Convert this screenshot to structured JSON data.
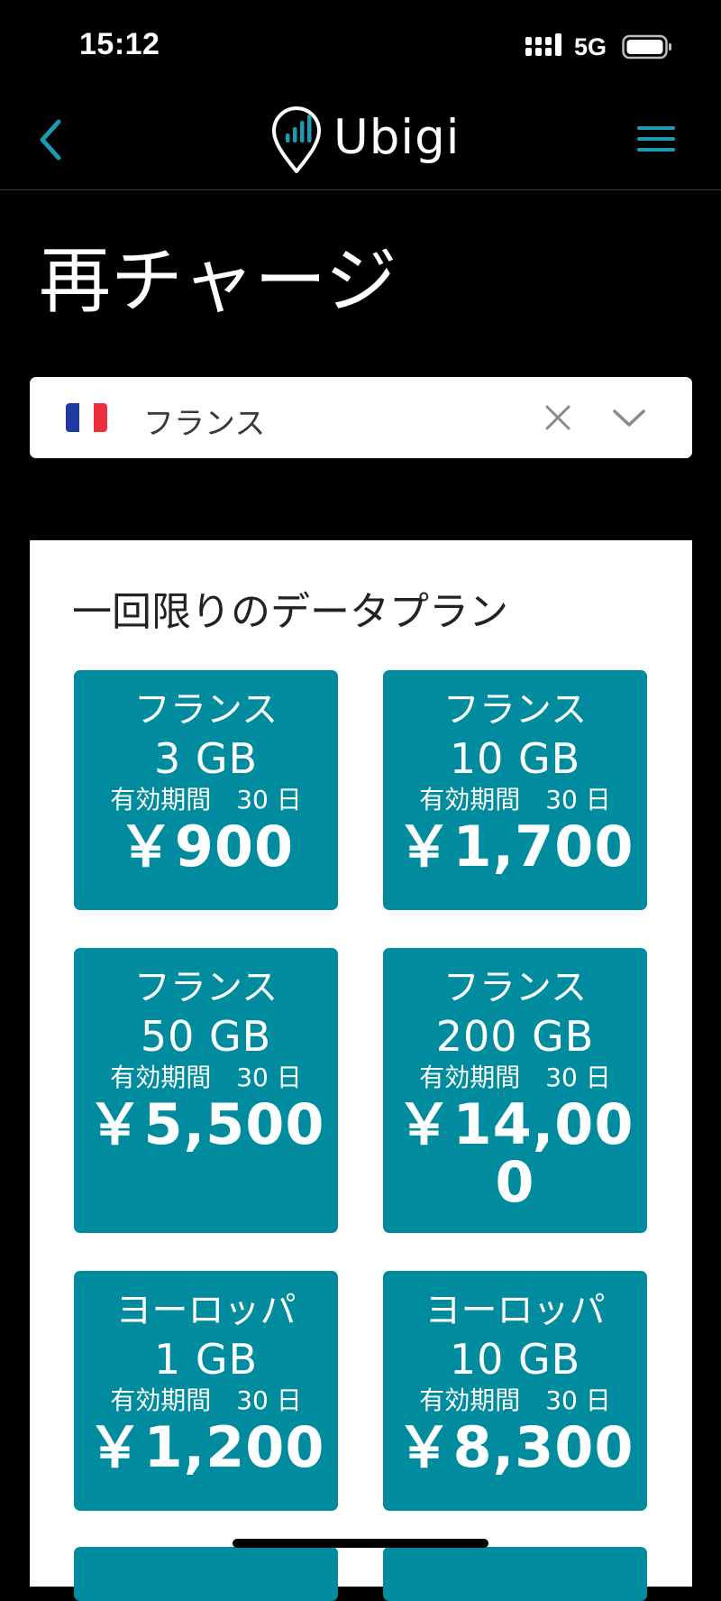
{
  "status_bar": {
    "time": "15:12",
    "network": "5G",
    "icons": [
      "signal-icon",
      "battery-icon"
    ]
  },
  "nav": {
    "logo_text": "Ubigi",
    "icons": [
      "back-arrow-icon",
      "location-pin-signal-icon",
      "hamburger-menu-icon"
    ],
    "accent_color": "#1a9bb0"
  },
  "page": {
    "title": "再チャージ"
  },
  "country_select": {
    "selected": "フランス",
    "flag": "france-flag-icon",
    "icons": [
      "clear-x-icon",
      "chevron-down-icon"
    ]
  },
  "plans": {
    "heading": "一回限りのデータプラン",
    "card_color": "#008c9e",
    "items": [
      {
        "region": "フランス",
        "data": "3 GB",
        "validity": "有効期間　30 日",
        "price": "￥900"
      },
      {
        "region": "フランス",
        "data": "10 GB",
        "validity": "有効期間　30 日",
        "price": "￥1,700"
      },
      {
        "region": "フランス",
        "data": "50 GB",
        "validity": "有効期間　30 日",
        "price": "￥5,500"
      },
      {
        "region": "フランス",
        "data": "200 GB",
        "validity": "有効期間　30 日",
        "price": "￥14,000"
      },
      {
        "region": "ヨーロッパ",
        "data": "1 GB",
        "validity": "有効期間　30 日",
        "price": "￥1,200"
      },
      {
        "region": "ヨーロッパ",
        "data": "10 GB",
        "validity": "有効期間　30 日",
        "price": "￥8,300"
      }
    ]
  }
}
